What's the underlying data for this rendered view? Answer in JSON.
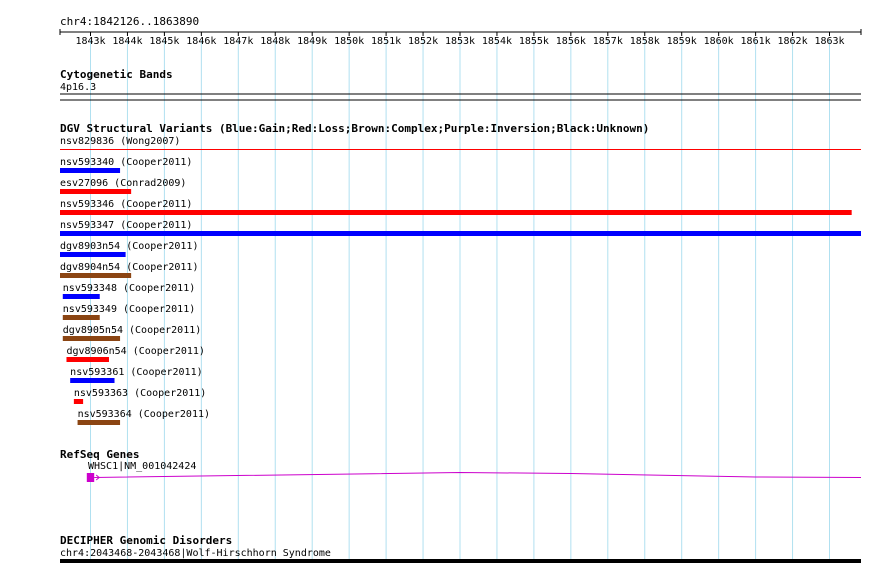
{
  "ruler": {
    "title": "chr4:1842126..1863890",
    "ticks": [
      "1843k",
      "1844k",
      "1845k",
      "1846k",
      "1847k",
      "1848k",
      "1849k",
      "1850k",
      "1851k",
      "1852k",
      "1853k",
      "1854k",
      "1855k",
      "1856k",
      "1857k",
      "1858k",
      "1859k",
      "1860k",
      "1861k",
      "1862k",
      "1863k"
    ]
  },
  "tracks": {
    "cytoband": {
      "title": "Cytogenetic Bands",
      "band": "4p16.3"
    },
    "dgv": {
      "title": "DGV Structural Variants (Blue:Gain;Red:Loss;Brown:Complex;Purple:Inversion;Black:Unknown)",
      "legend_colors": {
        "gain": "#0000ff",
        "loss": "#ff0000",
        "complex": "#8b4513",
        "inversion": "#800080",
        "unknown": "#000000"
      },
      "features": [
        {
          "label": "nsv829836 (Wong2007)",
          "type": "loss",
          "start_kb": 1842.1,
          "end_kb": 1863.9
        },
        {
          "label": "nsv593340 (Cooper2011)",
          "type": "gain",
          "start_kb": 1842.1,
          "end_kb": 1843.8
        },
        {
          "label": "esv27096 (Conrad2009)",
          "type": "loss",
          "start_kb": 1842.1,
          "end_kb": 1844.1
        },
        {
          "label": "nsv593346 (Cooper2011)",
          "type": "loss",
          "start_kb": 1842.1,
          "end_kb": 1863.6
        },
        {
          "label": "nsv593347 (Cooper2011)",
          "type": "gain",
          "start_kb": 1842.1,
          "end_kb": 1863.9
        },
        {
          "label": "dgv8903n54 (Cooper2011)",
          "type": "gain",
          "start_kb": 1842.1,
          "end_kb": 1843.95
        },
        {
          "label": "dgv8904n54 (Cooper2011)",
          "type": "complex",
          "start_kb": 1842.1,
          "end_kb": 1844.1
        },
        {
          "label": "nsv593348 (Cooper2011)",
          "type": "gain",
          "start_kb": 1842.25,
          "end_kb": 1843.25
        },
        {
          "label": "nsv593349 (Cooper2011)",
          "type": "complex",
          "start_kb": 1842.25,
          "end_kb": 1843.25
        },
        {
          "label": "dgv8905n54 (Cooper2011)",
          "type": "complex",
          "start_kb": 1842.25,
          "end_kb": 1843.8
        },
        {
          "label": "dgv8906n54 (Cooper2011)",
          "type": "loss",
          "start_kb": 1842.35,
          "end_kb": 1843.5
        },
        {
          "label": "nsv593361 (Cooper2011)",
          "type": "gain",
          "start_kb": 1842.45,
          "end_kb": 1843.65
        },
        {
          "label": "nsv593363 (Cooper2011)",
          "type": "loss",
          "start_kb": 1842.55,
          "end_kb": 1842.8
        },
        {
          "label": "nsv593364 (Cooper2011)",
          "type": "complex",
          "start_kb": 1842.65,
          "end_kb": 1843.8
        }
      ]
    },
    "refseq": {
      "title": "RefSeq Genes",
      "gene_label": "WHSC1|NM_001042424",
      "color": "#cc00cc",
      "exon_start_kb": 1842.9,
      "exon_end_kb": 1843.1,
      "intron_end_kb": 1863.9
    },
    "decipher": {
      "title": "DECIPHER Genomic Disorders",
      "entry": "chr4:2043468-2043468|Wolf-Hirschhorn Syndrome"
    }
  }
}
